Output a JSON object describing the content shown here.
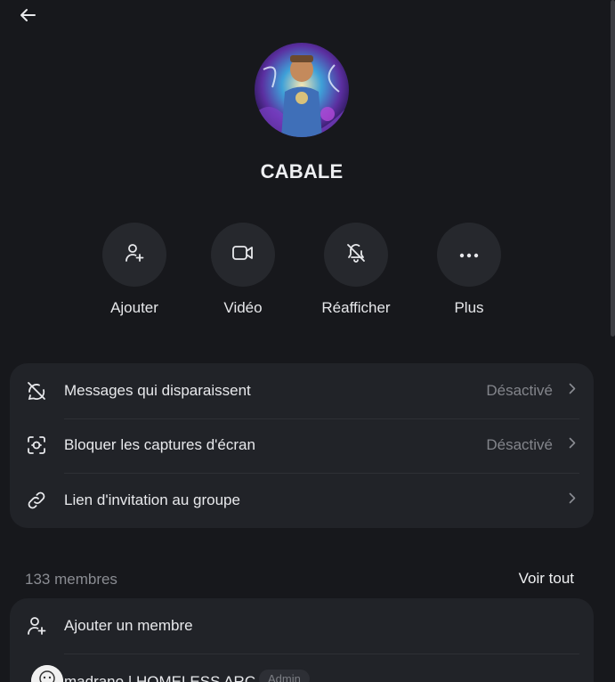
{
  "group": {
    "name": "CABALE"
  },
  "actions": [
    {
      "label": "Ajouter",
      "icon": "add-user-icon"
    },
    {
      "label": "Vidéo",
      "icon": "video-camera-icon"
    },
    {
      "label": "Réafficher",
      "icon": "bell-off-icon"
    },
    {
      "label": "Plus",
      "icon": "more-horizontal-icon"
    }
  ],
  "settings": [
    {
      "label": "Messages qui disparaissent",
      "value": "Désactivé",
      "icon": "disappearing-messages-icon"
    },
    {
      "label": "Bloquer les captures d'écran",
      "value": "Désactivé",
      "icon": "screenshot-block-icon"
    },
    {
      "label": "Lien d'invitation au groupe",
      "value": "",
      "icon": "link-icon"
    }
  ],
  "members": {
    "count_label": "133 membres",
    "see_all": "Voir tout",
    "add_label": "Ajouter un membre",
    "list": [
      {
        "name": "madrano | HOMELESS ARC",
        "badge": "Admin"
      }
    ]
  },
  "colors": {
    "background": "#17181c",
    "card": "#212328",
    "circle": "#26282d",
    "muted_text": "#83858b"
  }
}
